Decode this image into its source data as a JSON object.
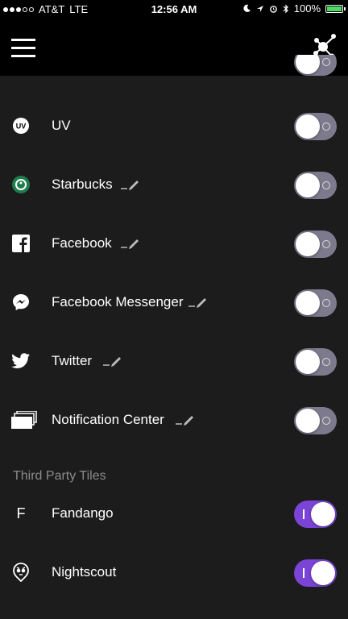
{
  "status_bar": {
    "carrier": "AT&T",
    "network": "LTE",
    "time": "12:56 AM",
    "battery": "100%"
  },
  "header": {
    "menu_icon": "hamburger-menu-icon",
    "right_icon": "cluster-nodes-icon"
  },
  "tiles": [
    {
      "label": "UV",
      "icon": "uv-icon",
      "editable": false,
      "enabled": false
    },
    {
      "label": "Starbucks",
      "icon": "starbucks-icon",
      "editable": true,
      "enabled": false
    },
    {
      "label": "Facebook",
      "icon": "facebook-icon",
      "editable": true,
      "enabled": false
    },
    {
      "label": "Facebook Messenger",
      "icon": "messenger-icon",
      "editable": true,
      "enabled": false
    },
    {
      "label": "Twitter",
      "icon": "twitter-icon",
      "editable": true,
      "enabled": false
    },
    {
      "label": "Notification Center",
      "icon": "notification-center-icon",
      "editable": true,
      "enabled": false
    }
  ],
  "third_party": {
    "title": "Third Party Tiles",
    "tiles": [
      {
        "label": "Fandango",
        "icon": "fandango-icon",
        "icon_text": "F",
        "enabled": true
      },
      {
        "label": "Nightscout",
        "icon": "nightscout-icon",
        "enabled": true
      }
    ]
  },
  "colors": {
    "toggle_on": "#7b44d6",
    "toggle_off": "#7c7a8c",
    "background": "#1c1c1c",
    "header": "#000000"
  }
}
